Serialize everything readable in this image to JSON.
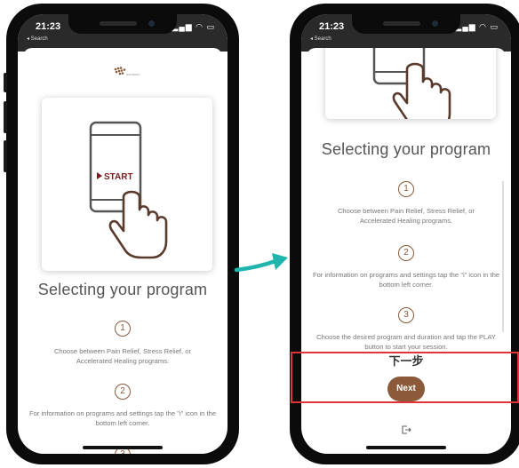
{
  "status": {
    "time": "21:23",
    "back_label": "◂ Search"
  },
  "brand": {
    "name": "pompom"
  },
  "card": {
    "button_label": "START"
  },
  "screen": {
    "title": "Selecting your program",
    "steps": [
      {
        "number": "1",
        "text": "Choose between Pain Relief, Stress Relief, or Accelerated Healing programs."
      },
      {
        "number": "2",
        "text": "For information on programs and settings tap the \"i\" icon in the bottom left corner."
      },
      {
        "number": "3",
        "text": "Choose the desired program and duration and tap the PLAY button to start your session."
      }
    ],
    "next_button": "Next"
  },
  "annotation": {
    "label_cn": "下一步"
  },
  "icons": {
    "exit": "exit-icon",
    "hand": "pointing-hand-icon",
    "arrow": "arrow-icon"
  },
  "colors": {
    "accent": "#8a5a3b",
    "highlight": "#e2323a",
    "arrow": "#1fb5ad"
  }
}
